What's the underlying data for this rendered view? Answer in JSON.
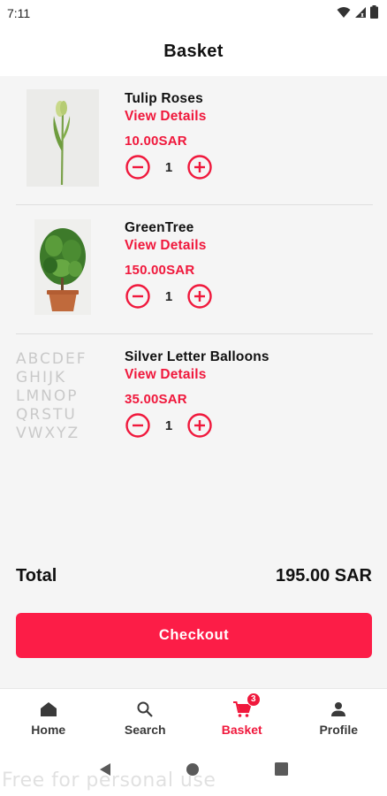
{
  "status_bar": {
    "time": "7:11"
  },
  "header": {
    "title": "Basket"
  },
  "items": [
    {
      "name": "Tulip Roses",
      "details_label": "View Details",
      "price": "10.00SAR",
      "quantity": "1"
    },
    {
      "name": "GreenTree",
      "details_label": "View Details",
      "price": "150.00SAR",
      "quantity": "1"
    },
    {
      "name": "Silver Letter Balloons",
      "details_label": "View Details",
      "price": "35.00SAR",
      "quantity": "1"
    }
  ],
  "balloon_letters": [
    "ABCDEF",
    "GHIJK",
    "LMNOP",
    "QRSTU",
    "VWXYZ"
  ],
  "summary": {
    "total_label": "Total",
    "total_value": "195.00 SAR"
  },
  "checkout_label": "Checkout",
  "nav": {
    "home": "Home",
    "search": "Search",
    "basket": "Basket",
    "basket_badge": "3",
    "profile": "Profile"
  },
  "watermark": "Free for personal use",
  "colors": {
    "accent": "#f0183c",
    "button": "#fc1d47"
  }
}
